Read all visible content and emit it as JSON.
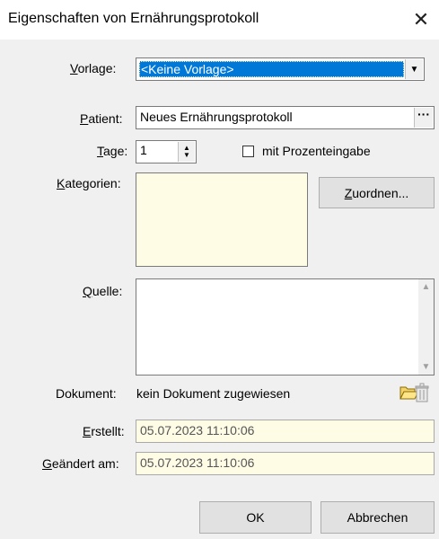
{
  "window": {
    "title": "Eigenschaften von Ernährungsprotokoll",
    "close_glyph": "✕"
  },
  "form": {
    "vorlage": {
      "label_ul": "V",
      "label_rest": "orlage:",
      "value": "<Keine Vorlage>"
    },
    "patient": {
      "label_ul": "P",
      "label_rest": "atient:",
      "value": "Neues Ernährungsprotokoll",
      "browse": "···"
    },
    "tage": {
      "label_ul": "T",
      "label_rest": "age:",
      "value": "1"
    },
    "prozent": {
      "label": "mit Prozenteingabe",
      "checked": false
    },
    "kategorien": {
      "label_ul": "K",
      "label_rest": "ategorien:",
      "button_ul": "Z",
      "button_rest": "uordnen..."
    },
    "quelle": {
      "label_ul": "Q",
      "label_rest": "uelle:",
      "value": ""
    },
    "dokument": {
      "label": "Dokument:",
      "value": "kein Dokument zugewiesen",
      "folder_icon": "folder-open-icon",
      "trash_icon": "trash-icon"
    },
    "erstellt": {
      "label_ul": "E",
      "label_rest": "rstellt:",
      "value": "05.07.2023 11:10:06"
    },
    "geaendert": {
      "label_ul": "G",
      "label_rest": "eändert am:",
      "value": "05.07.2023 11:10:06"
    }
  },
  "buttons": {
    "ok": "OK",
    "cancel": "Abbrechen"
  },
  "colors": {
    "selection": "#0078d7",
    "readonly_bg": "#fffce6",
    "dialog_bg": "#f0f0f0"
  }
}
